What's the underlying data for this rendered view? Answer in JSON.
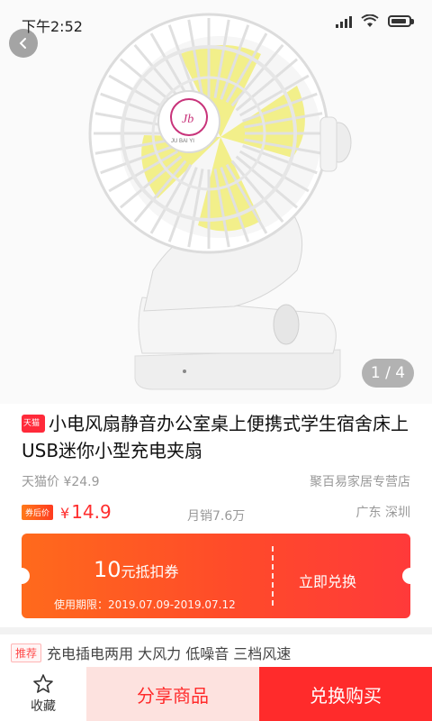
{
  "status_bar": {
    "time": "下午2:52"
  },
  "gallery": {
    "page_indicator": "1 / 4",
    "logo_text": "JU BAI YI"
  },
  "product": {
    "badge": "天猫",
    "title": "小电风扇静音办公室桌上便携式学生宿舍床上USB迷你小型充电夹扇",
    "tmall_price": "天猫价 ¥24.9",
    "store_name": "聚百易家居专营店",
    "coupon_tag": "券后价",
    "price_sign": "¥",
    "price": "14.9",
    "sales": "月销7.6万",
    "location": "广东 深圳"
  },
  "coupon": {
    "amount": "10",
    "amount_unit": "元抵扣券",
    "action": "立即兑换",
    "validity": "使用期限：2019.07.09-2019.07.12"
  },
  "recommend": {
    "label": "推荐",
    "text": "充电插电两用 大风力 低噪音 三档风速"
  },
  "bottom_bar": {
    "favorite": "收藏",
    "share": "分享商品",
    "buy": "兑换购买"
  },
  "colors": {
    "accent": "#ff2b2b",
    "coupon_start": "#ff6a1c",
    "coupon_end": "#ff3a3a",
    "share_bg": "#fde2df",
    "fan_body": "#ffffff",
    "fan_blade": "#f2ef8a"
  }
}
